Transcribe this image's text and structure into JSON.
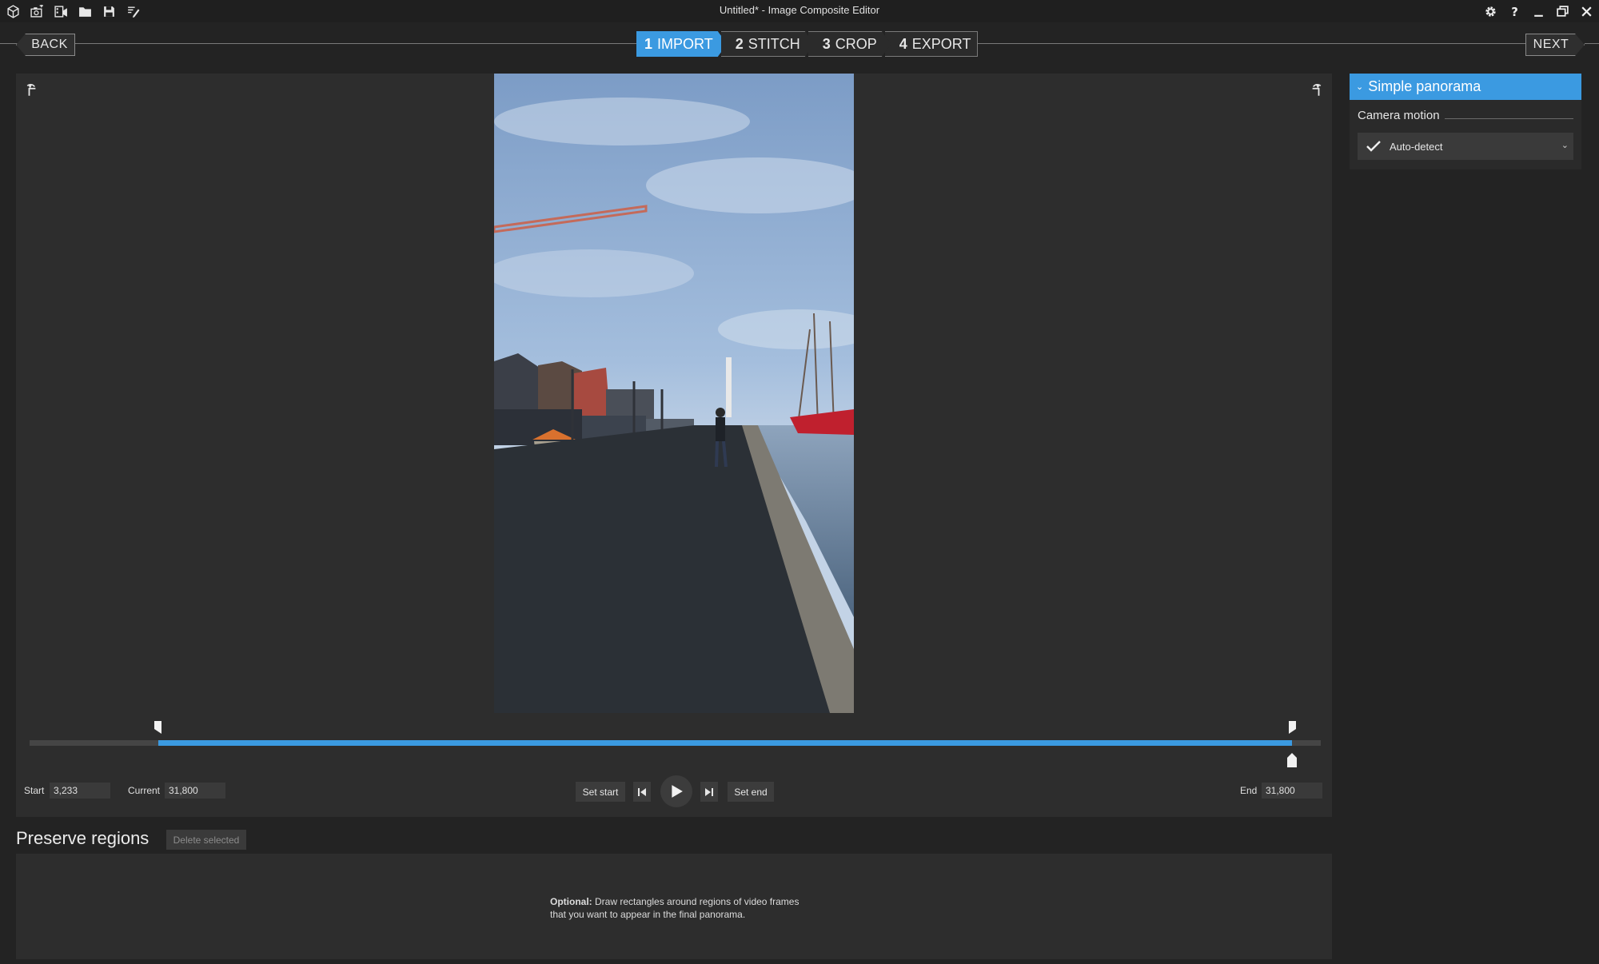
{
  "titlebar": {
    "title": "Untitled* - Image Composite Editor",
    "left_icons": [
      "new-panorama-icon",
      "new-from-camera-icon",
      "new-from-video-icon",
      "open-folder-icon",
      "save-icon",
      "edit-icon"
    ],
    "right_icons": [
      "gear-icon",
      "help-icon",
      "minimize-icon",
      "restore-icon",
      "close-icon"
    ]
  },
  "nav": {
    "back_label": "BACK",
    "next_label": "NEXT",
    "steps": [
      {
        "num": "1",
        "label": "IMPORT",
        "active": true
      },
      {
        "num": "2",
        "label": "STITCH",
        "active": false
      },
      {
        "num": "3",
        "label": "CROP",
        "active": false
      },
      {
        "num": "4",
        "label": "EXPORT",
        "active": false
      }
    ]
  },
  "timeline": {
    "start_label": "Start",
    "start_value": "3,233",
    "current_label": "Current",
    "current_value": "31,800",
    "end_label": "End",
    "end_value": "31,800",
    "set_start_label": "Set start",
    "set_end_label": "Set end",
    "start_fraction": 0.0995,
    "end_fraction": 0.9778,
    "current_fraction": 0.9778
  },
  "panel": {
    "header": "Simple panorama",
    "camera_motion_label": "Camera motion",
    "camera_motion_value": "Auto-detect"
  },
  "preserve": {
    "title": "Preserve regions",
    "delete_label": "Delete selected",
    "hint_bold": "Optional:",
    "hint_text": " Draw rectangles around regions of video frames that you want to appear in the final panorama."
  },
  "colors": {
    "accent": "#3b9ae1",
    "background": "#232323",
    "panel": "#2d2d2d"
  }
}
